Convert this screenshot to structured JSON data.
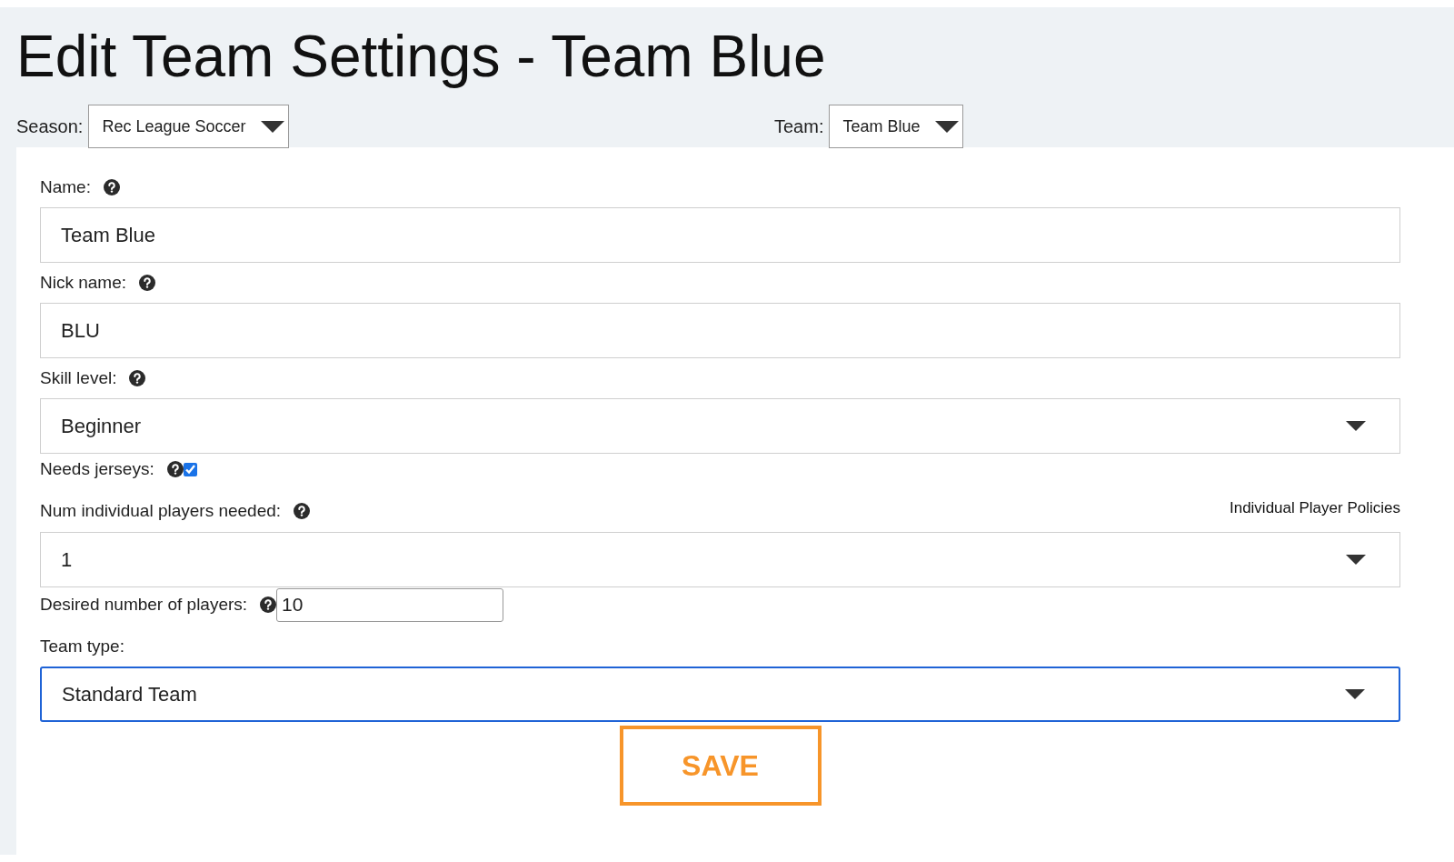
{
  "title": "Edit Team Settings - Team Blue",
  "filters": [
    {
      "label": "Season:",
      "value": "Rec League Soccer"
    },
    {
      "label": "Team:",
      "value": "Team Blue"
    }
  ],
  "fields": [
    {
      "kind": "text",
      "label": "Name:",
      "help": true,
      "value": "Team Blue"
    },
    {
      "kind": "text",
      "label": "Nick name:",
      "help": true,
      "value": "BLU"
    },
    {
      "kind": "select",
      "label": "Skill level:",
      "help": true,
      "value": "Beginner",
      "focused": false
    },
    {
      "kind": "checkbox",
      "label": "Needs jerseys:",
      "help": true,
      "checked": true
    },
    {
      "kind": "select",
      "label": "Num individual players needed:",
      "help": true,
      "link": "Individual Player Policies",
      "value": "1",
      "focused": false
    },
    {
      "kind": "short",
      "label": "Desired number of players:",
      "help": true,
      "value": "10"
    },
    {
      "kind": "select",
      "label": "Team type:",
      "help": false,
      "value": "Standard Team",
      "focused": true
    }
  ],
  "save_button": "SAVE"
}
